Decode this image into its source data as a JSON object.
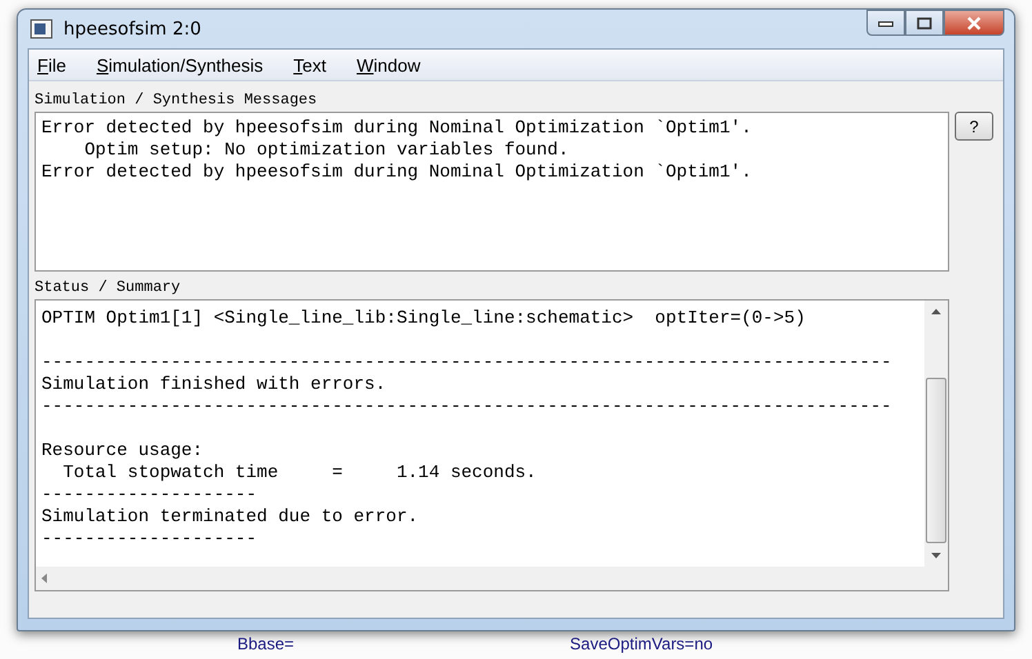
{
  "window": {
    "title": "hpeesofsim 2:0"
  },
  "menu": [
    {
      "label": "File"
    },
    {
      "label": "Simulation/Synthesis"
    },
    {
      "label": "Text"
    },
    {
      "label": "Window"
    }
  ],
  "messages": {
    "label": "Simulation / Synthesis Messages",
    "lines": [
      "Error detected by hpeesofsim during Nominal Optimization `Optim1'.",
      "    Optim setup: No optimization variables found.",
      "Error detected by hpeesofsim during Nominal Optimization `Optim1'."
    ],
    "help_button": "?"
  },
  "status": {
    "label": "Status / Summary",
    "paragraphs": [
      [
        "OPTIM Optim1[1] <Single_line_lib:Single_line:schematic>  optIter=(0->5)"
      ],
      [
        "-------------------------------------------------------------------------------",
        "Simulation finished with errors.",
        "-------------------------------------------------------------------------------"
      ],
      [
        "Resource usage:",
        "  Total stopwatch time     =     1.14 seconds.",
        "--------------------",
        "Simulation terminated due to error.",
        "--------------------"
      ]
    ]
  },
  "background": {
    "labels": [
      "Bbase=",
      "SaveOptimVars=no"
    ]
  }
}
